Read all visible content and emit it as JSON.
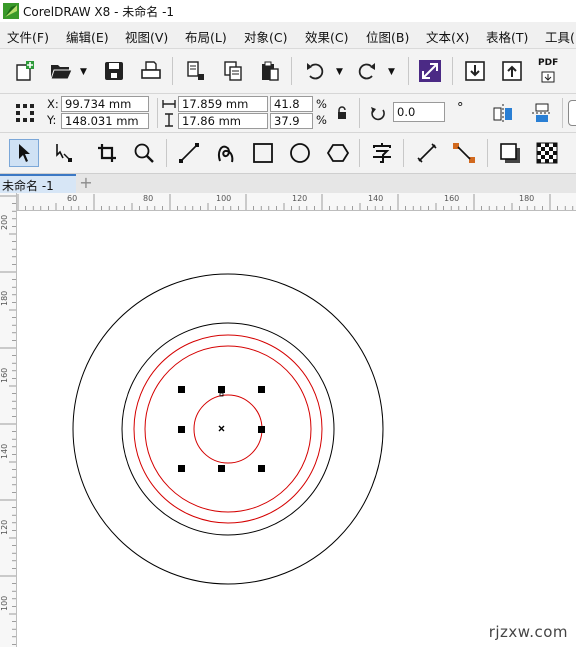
{
  "title": {
    "app": "CorelDRAW X8",
    "sep": " - ",
    "doc": "未命名 -1"
  },
  "menu": [
    "文件(F)",
    "编辑(E)",
    "视图(V)",
    "布局(L)",
    "对象(C)",
    "效果(C)",
    "位图(B)",
    "文本(X)",
    "表格(T)",
    "工具("
  ],
  "icons": {
    "toolbar": [
      "new-document-icon",
      "open-folder-icon",
      "save-icon",
      "print-icon",
      "cut-icon",
      "copy-icon",
      "paste-icon",
      "undo-icon",
      "redo-icon",
      "corel-connect-icon",
      "import-icon",
      "export-icon",
      "pdf-icon"
    ],
    "toolbox": [
      "pick-tool-icon",
      "shape-tool-icon",
      "crop-tool-icon",
      "zoom-tool-icon",
      "freehand-tool-icon",
      "artistic-media-icon",
      "rectangle-tool-icon",
      "ellipse-tool-icon",
      "polygon-tool-icon",
      "text-tool-icon",
      "parallel-dimension-icon",
      "connector-tool-icon",
      "drop-shadow-icon",
      "transparency-icon"
    ]
  },
  "toolbar": {
    "pdf_label": "PDF"
  },
  "property_bar": {
    "x_label": "X:",
    "x_value": "99.734 mm",
    "y_label": "Y:",
    "y_value": "148.031 mm",
    "width_value": "17.859 mm",
    "height_value": "17.86 mm",
    "scale_x": "41.8",
    "scale_y": "37.9",
    "percent": "%",
    "rotation": "0.0",
    "degree": "°"
  },
  "document_tabs": [
    {
      "label": "未命名 -1",
      "active": true
    }
  ],
  "ruler": {
    "horizontal": [
      "60",
      "80",
      "100",
      "120",
      "140",
      "160",
      "180"
    ],
    "vertical": [
      "200",
      "180",
      "160",
      "140",
      "120",
      "100"
    ]
  },
  "colors": {
    "outline_black": "#000000",
    "outline_red": "#d40000",
    "accent_blue": "#3b78c4",
    "connect_purple": "#4b2a85"
  },
  "watermark": "rjzxw.com"
}
